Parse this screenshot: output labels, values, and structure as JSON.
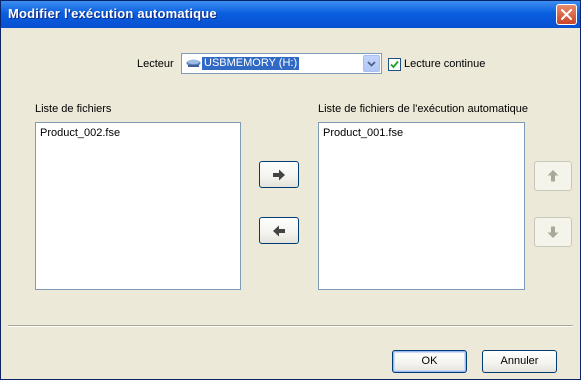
{
  "dialog": {
    "title": "Modifier l'exécution automatique"
  },
  "drive": {
    "label": "Lecteur",
    "selected": "USBMEMORY (H:)",
    "icon": "drive-icon"
  },
  "continuous_play": {
    "label": "Lecture continue",
    "checked": true
  },
  "file_list": {
    "label": "Liste de fichiers",
    "items": [
      "Product_002.fse"
    ]
  },
  "autorun_list": {
    "label": "Liste de fichiers de l'exécution automatique",
    "items": [
      "Product_001.fse"
    ]
  },
  "buttons": {
    "ok": "OK",
    "cancel": "Annuler"
  },
  "colors": {
    "titlebar": "#0a5fe0",
    "selection": "#316ac5",
    "dialog_bg": "#ece9d8"
  }
}
